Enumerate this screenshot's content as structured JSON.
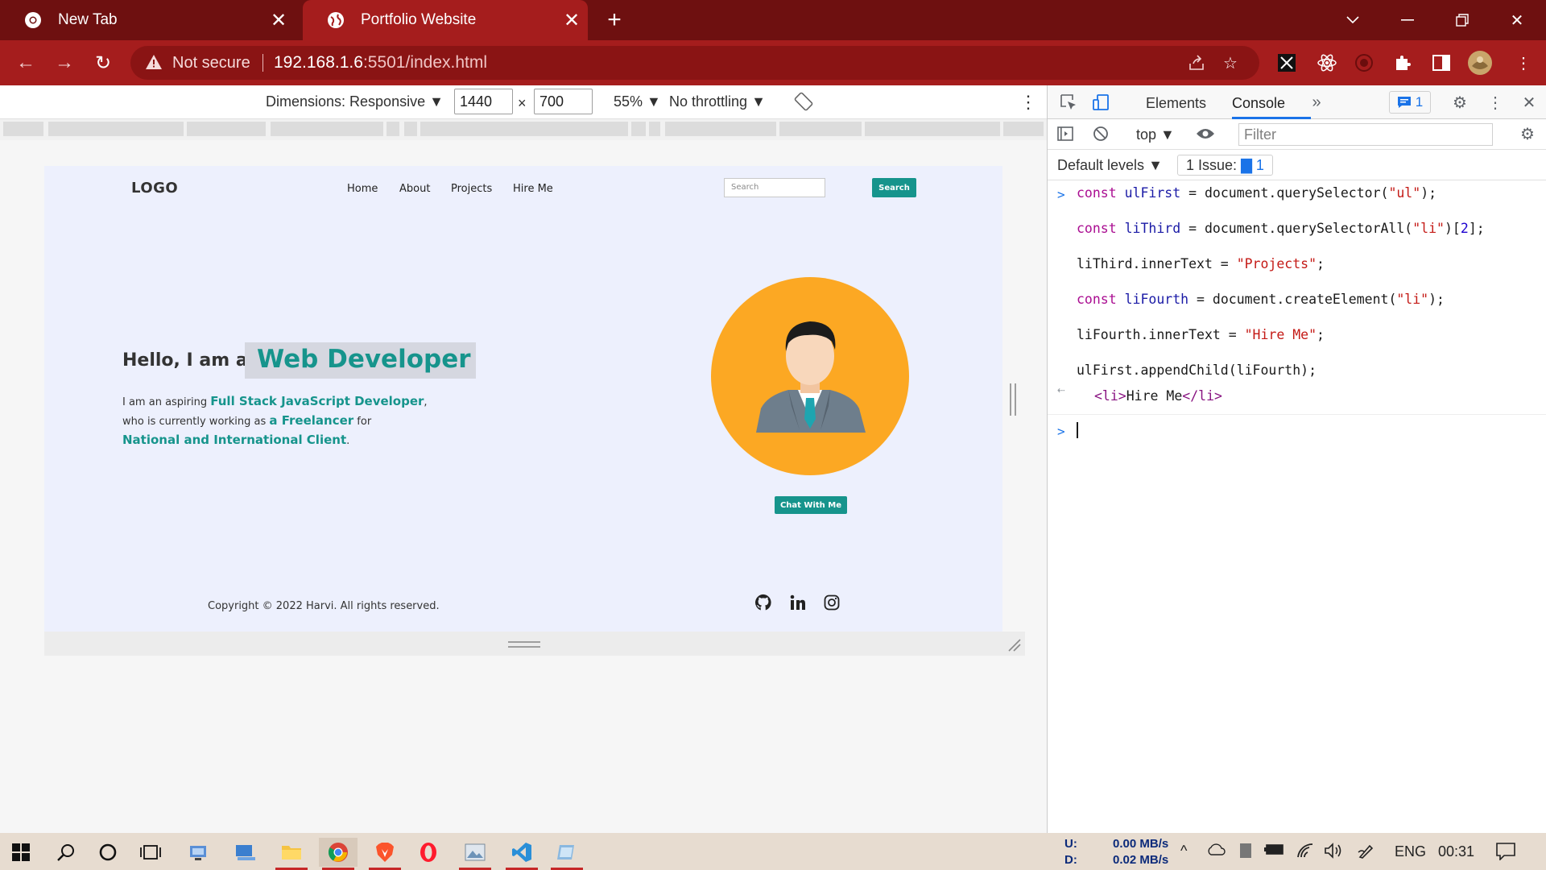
{
  "browser": {
    "tabs": [
      {
        "title": "New Tab",
        "active": false
      },
      {
        "title": "Portfolio Website",
        "active": true
      }
    ],
    "address": {
      "security_label": "Not secure",
      "url_host": "192.168.1.6",
      "url_rest": ":5501/index.html"
    }
  },
  "device_toolbar": {
    "dimensions_label": "Dimensions: Responsive",
    "width": "1440",
    "height": "700",
    "times": "×",
    "zoom": "55%",
    "throttling": "No throttling"
  },
  "site": {
    "logo": "LOGO",
    "nav": [
      "Home",
      "About",
      "Projects",
      "Hire Me"
    ],
    "search_placeholder": "Search",
    "search_button": "Search",
    "hello": "Hello, I am a",
    "role": "Web Developer",
    "bio": {
      "line1_prefix": "I am an aspiring ",
      "line1_bold": "Full Stack JavaScript Developer",
      "line1_suffix": ",",
      "line2_prefix": "who is currently working as ",
      "line2_bold": "a Freelancer",
      "line2_suffix": " for",
      "line3_bold": "National and International Client",
      "line3_suffix": "."
    },
    "chat_button": "Chat With Me",
    "copyright": "Copyright © 2022 Harvi. All rights reserved.",
    "social": [
      "github-icon",
      "linkedin-icon",
      "instagram-icon"
    ],
    "colors": {
      "accent": "#16948c",
      "page_bg": "#edf0fd",
      "avatar_bg": "#fca823"
    }
  },
  "devtools": {
    "tabs": [
      "Elements",
      "Console"
    ],
    "active_tab": "Console",
    "issue_count": "1",
    "context": "top",
    "filter_placeholder": "Filter",
    "levels": "Default levels",
    "issues_label": "1 Issue:",
    "issues_count": "1",
    "console": {
      "lines": [
        {
          "kw": "const",
          "var": "ulFirst",
          "rest": " = document.querySelector(",
          "str": "\"ul\"",
          "end": ");"
        },
        {
          "kw": "const",
          "var": "liThird",
          "rest": " = document.querySelectorAll(",
          "str": "\"li\"",
          "end": ")[",
          "num": "2",
          "end2": "];"
        },
        {
          "plain": "liThird.innerText = ",
          "str": "\"Projects\"",
          "end": ";"
        },
        {
          "kw": "const",
          "var": "liFourth",
          "rest": " = document.createElement(",
          "str": "\"li\"",
          "end": ");"
        },
        {
          "plain": "liFourth.innerText = ",
          "str": "\"Hire Me\"",
          "end": ";"
        },
        {
          "plain": "ulFirst.appendChild(liFourth);"
        }
      ],
      "result_open": "<li>",
      "result_text": "Hire Me",
      "result_close": "</li>"
    }
  },
  "taskbar": {
    "upload_label": "U:",
    "download_label": "D:",
    "upload_speed": "0.00 MB/s",
    "download_speed": "0.02 MB/s",
    "language": "ENG",
    "time": "00:31"
  }
}
